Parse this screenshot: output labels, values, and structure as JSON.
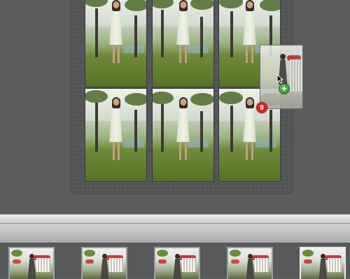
{
  "grid": {
    "photos": [
      {
        "id": "photo-1"
      },
      {
        "id": "photo-2"
      },
      {
        "id": "photo-3"
      },
      {
        "id": "photo-4"
      },
      {
        "id": "photo-5"
      },
      {
        "id": "photo-6"
      }
    ]
  },
  "drag": {
    "badge_count": "9",
    "add_symbol": "+",
    "icons": [
      "arrow-cursor-icon",
      "add-plus-icon"
    ]
  },
  "filmstrip": {
    "thumbnails": [
      {
        "id": "thumb-1",
        "selected": false
      },
      {
        "id": "thumb-2",
        "selected": false
      },
      {
        "id": "thumb-3",
        "selected": false
      },
      {
        "id": "thumb-4",
        "selected": false
      },
      {
        "id": "thumb-5",
        "selected": true
      }
    ]
  },
  "colors": {
    "background": "#5c5d5f",
    "badge": "#c8262a",
    "plus": "#2a8b2a"
  }
}
